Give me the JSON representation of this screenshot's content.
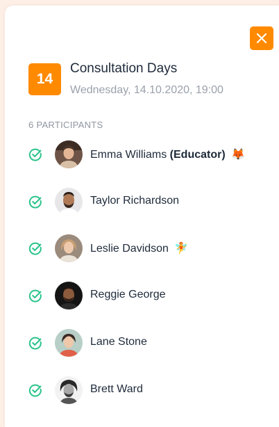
{
  "event": {
    "day": "14",
    "title": "Consultation Days",
    "datetime": "Wednesday, 14.10.2020, 19:00"
  },
  "participants_label": "6 PARTICIPANTS",
  "participants": [
    {
      "name": "Emma Williams",
      "role": "(Educator)",
      "emoji": "🦊",
      "confirmed": true
    },
    {
      "name": "Taylor Richardson",
      "role": "",
      "emoji": "",
      "confirmed": true
    },
    {
      "name": "Leslie Davidson",
      "role": "",
      "emoji": "🧚",
      "confirmed": true
    },
    {
      "name": "Reggie George",
      "role": "",
      "emoji": "",
      "confirmed": true
    },
    {
      "name": "Lane Stone",
      "role": "",
      "emoji": "",
      "confirmed": true
    },
    {
      "name": "Brett Ward",
      "role": "",
      "emoji": "",
      "confirmed": true
    }
  ],
  "colors": {
    "accent": "#ff8a00",
    "check": "#2bc48a",
    "text": "#1e2a3a",
    "muted": "#9aa1ab",
    "backdrop": "#fdeee6"
  },
  "icons": {
    "close": "close-icon",
    "check": "check-circle-icon"
  }
}
